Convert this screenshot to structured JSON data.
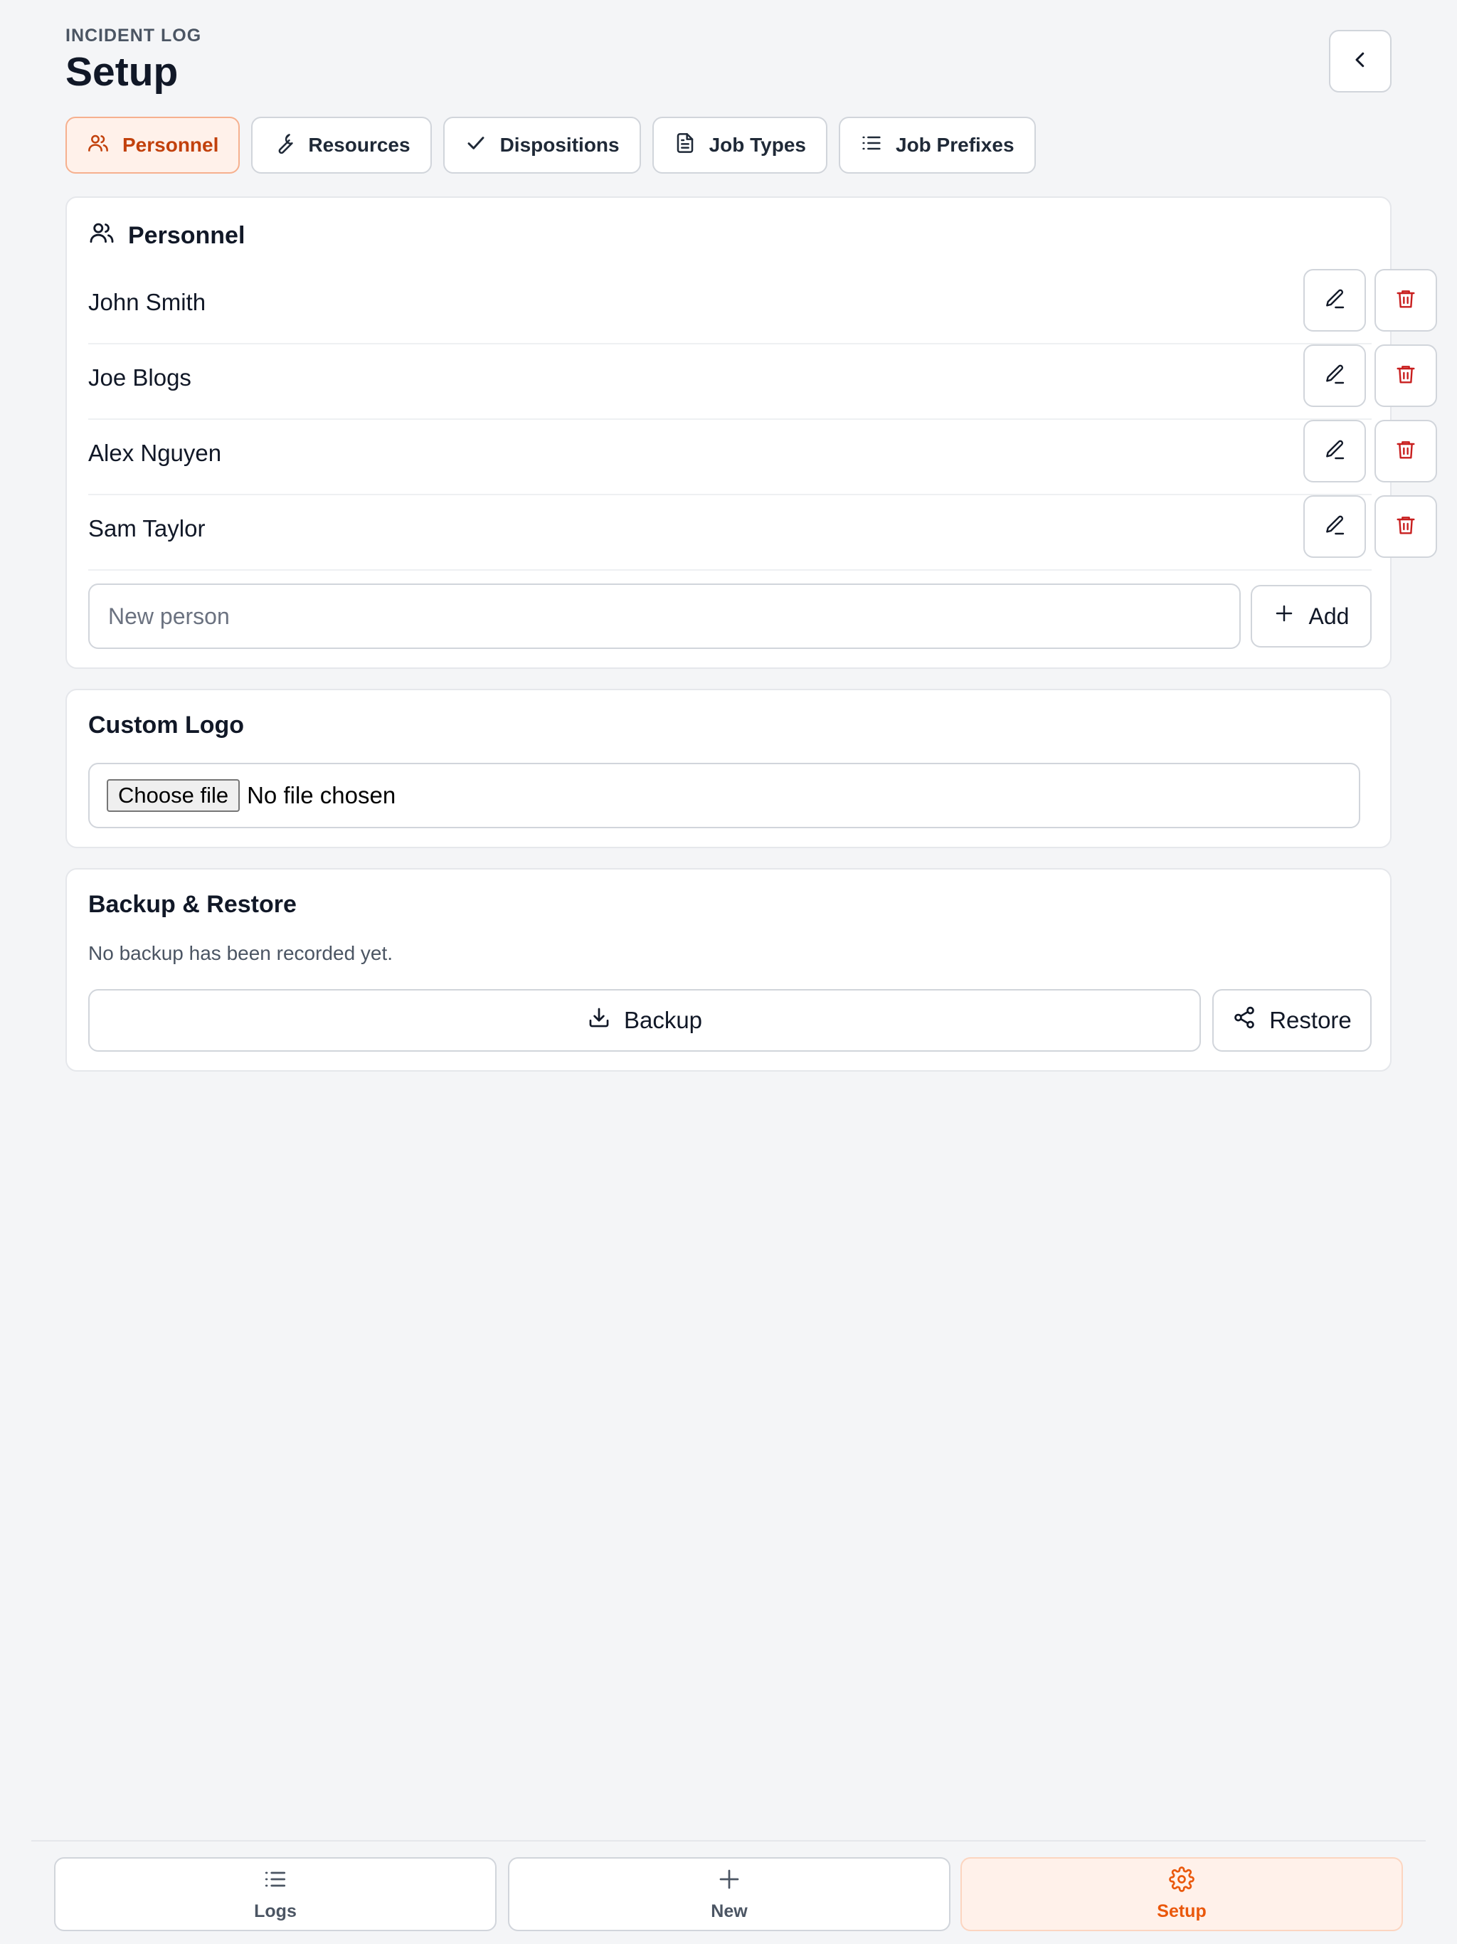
{
  "header": {
    "eyebrow": "INCIDENT LOG",
    "title": "Setup",
    "back_icon": "chevron-left-icon"
  },
  "tabs": [
    {
      "label": "Personnel",
      "icon": "users-icon",
      "active": true
    },
    {
      "label": "Resources",
      "icon": "wrench-icon",
      "active": false
    },
    {
      "label": "Dispositions",
      "icon": "check-icon",
      "active": false
    },
    {
      "label": "Job Types",
      "icon": "file-text-icon",
      "active": false
    },
    {
      "label": "Job Prefixes",
      "icon": "list-icon",
      "active": false
    }
  ],
  "personnel": {
    "title": "Personnel",
    "people": [
      "John Smith",
      "Joe Blogs",
      "Alex Nguyen",
      "Sam Taylor"
    ],
    "new_placeholder": "New person",
    "add_label": "Add"
  },
  "logo": {
    "title": "Custom Logo",
    "choose_label": "Choose file",
    "file_status": "No file chosen"
  },
  "backup": {
    "title": "Backup & Restore",
    "note": "No backup has been recorded yet.",
    "backup_label": "Backup",
    "restore_label": "Restore"
  },
  "bottom_nav": [
    {
      "label": "Logs",
      "icon": "list-icon",
      "active": false
    },
    {
      "label": "New",
      "icon": "plus-icon",
      "active": false
    },
    {
      "label": "Setup",
      "icon": "gear-icon",
      "active": true
    }
  ],
  "colors": {
    "accent": "#ea580c",
    "accent_bg": "#fff1ea",
    "danger": "#c81e1e",
    "background": "#f4f5f7"
  }
}
